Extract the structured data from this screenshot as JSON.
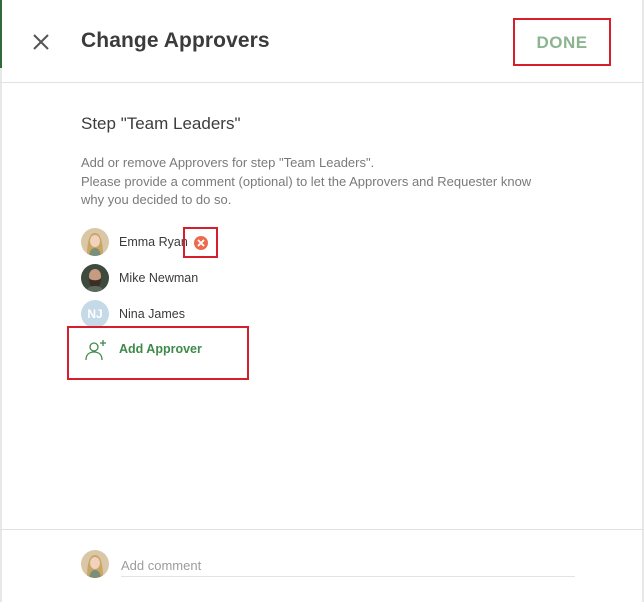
{
  "header": {
    "title": "Change Approvers",
    "done_label": "DONE",
    "close_icon": "close-icon"
  },
  "step": {
    "title": "Step \"Team Leaders\"",
    "description_lines": [
      "Add or remove Approvers for step \"Team Leaders\".",
      "Please provide a comment (optional) to let the Approvers and Requester know",
      "why you decided to do so."
    ]
  },
  "approvers": [
    {
      "name": "Emma Ryan",
      "avatar": "photo-avatar-blonde",
      "removable": true,
      "remove_icon": "remove-circle-x-icon"
    },
    {
      "name": "Mike Newman",
      "avatar": "photo-avatar-bearded"
    },
    {
      "name": "Nina James",
      "initials": "NJ"
    }
  ],
  "add_approver": {
    "label": "Add Approver",
    "icon": "add-person-icon"
  },
  "comment": {
    "placeholder": "Add comment",
    "avatar": "photo-avatar-blonde"
  },
  "colors": {
    "accent_green": "#3e8a4a",
    "done_text": "#8bb48f",
    "highlight_red": "#d61f2c",
    "remove_orange": "#ec6b4f",
    "initials_bg": "#c6d9e6"
  }
}
